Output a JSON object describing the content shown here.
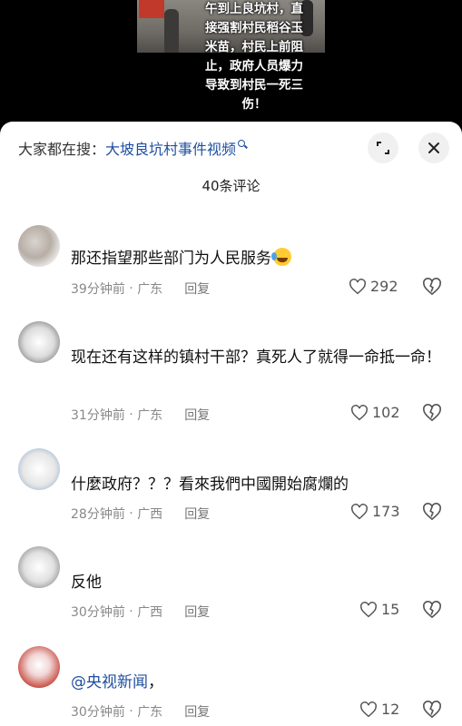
{
  "video": {
    "caption_lines": [
      "午到上良坑村，直",
      "接强割村民稻谷玉",
      "米苗，村民上前阻",
      "止，政府人员爆力",
      "导致到村民一死三",
      "伤！"
    ]
  },
  "sheet": {
    "search_prefix": "大家都在搜：",
    "search_term": "大坡良坑村事件视频",
    "comment_count": "40条评论"
  },
  "comments": [
    {
      "username": "",
      "text": "那还指望那些部门为人民服务",
      "time": "39分钟前",
      "location": "广东",
      "reply": "回复",
      "likes": "292"
    },
    {
      "username": "",
      "text": "现在还有这样的镇村干部？真死人了就得一命抵一命！",
      "time": "31分钟前",
      "location": "广东",
      "reply": "回复",
      "likes": "102"
    },
    {
      "username": "",
      "text": "什麼政府？？？看來我們中國開始腐爛的",
      "time": "28分钟前",
      "location": "广西",
      "reply": "回复",
      "likes": "173"
    },
    {
      "username": "",
      "text": "反他",
      "time": "30分钟前",
      "location": "广西",
      "reply": "回复",
      "likes": "15"
    },
    {
      "username": "",
      "mention": "@央视新闻",
      "text": "，",
      "time": "30分钟前",
      "location": "广东",
      "reply": "回复",
      "likes": "12"
    }
  ],
  "icons": {
    "expand": "expand-icon",
    "close": "close-icon",
    "like": "heart-outline-icon",
    "dislike": "broken-heart-icon",
    "search": "search-icon"
  },
  "colors": {
    "link": "#1f4fa0",
    "meta": "#888888",
    "sheet_bg": "#ffffff",
    "top_bg": "#000000"
  }
}
